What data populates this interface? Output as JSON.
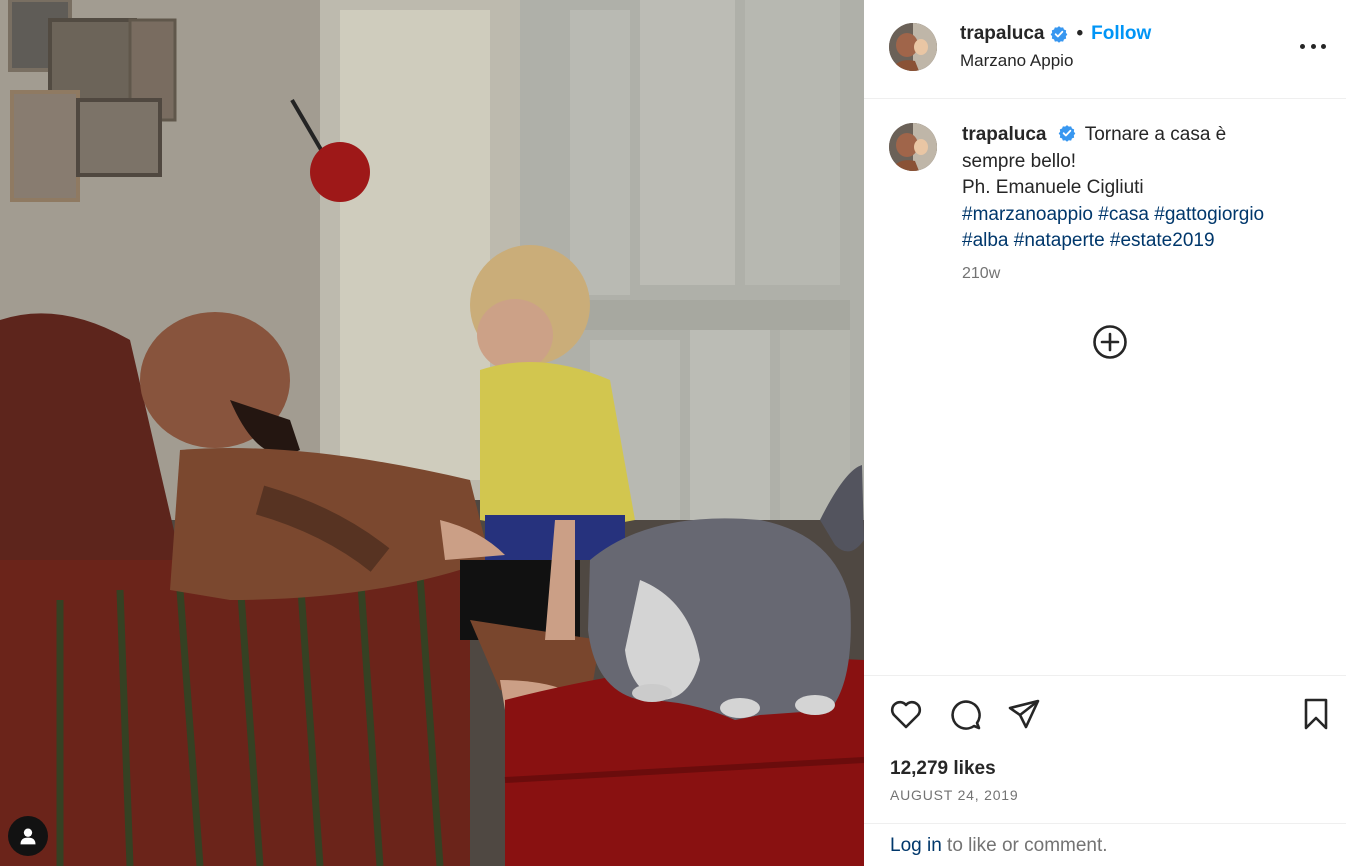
{
  "post": {
    "photo_alt": "",
    "author": {
      "username": "trapaluca",
      "verified": true,
      "location": "Marzano Appio",
      "follow_label": "Follow"
    },
    "caption": {
      "username": "trapaluca",
      "line1": "Tornare a casa è",
      "line2": "sempre bello!",
      "line3": "Ph. Emanuele Cigliuti",
      "hashtags_line1": [
        "#marzanoappio",
        "#casa",
        "#gattogiorgio"
      ],
      "hashtags_line2": [
        "#alba",
        "#nataperte",
        "#estate2019"
      ],
      "time_ago": "210w"
    },
    "likes": "12,279 likes",
    "date": "AUGUST 24, 2019",
    "login": {
      "link": "Log in",
      "rest": " to like or comment."
    }
  },
  "icons": {
    "more": "more-options-icon",
    "verified": "verified-badge-icon",
    "load_more": "plus-circle-icon",
    "like": "heart-icon",
    "comment": "comment-icon",
    "share": "share-icon",
    "save": "bookmark-icon",
    "user_tag": "user-icon"
  },
  "colors": {
    "accent": "#0095f6",
    "hashtag": "#00376b",
    "verified": "#3897f0",
    "secondary_text": "#737373"
  }
}
